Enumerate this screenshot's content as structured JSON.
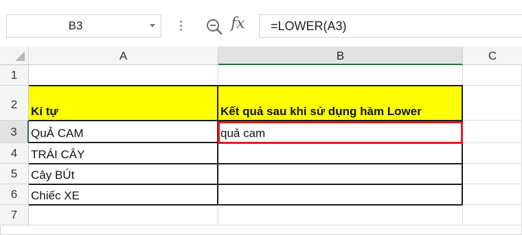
{
  "formula_bar": {
    "name_box": "B3",
    "formula": "=LOWER(A3)",
    "zoom_icon": "zoom-icon",
    "fx_label": "fx"
  },
  "columns": [
    "A",
    "B",
    "C"
  ],
  "rows": [
    "1",
    "2",
    "3",
    "4",
    "5",
    "6",
    "7"
  ],
  "cells": {
    "A2": "Kí tự",
    "B2": "Kết quả sau khi sử dụng hàm Lower",
    "A3": "QuẢ CAM",
    "B3": "quả cam",
    "A4": "TRÁI CÂY",
    "A5": "Cây BÚt",
    "A6": "Chiếc XE"
  },
  "colors": {
    "header_fill": "#ffff00",
    "selection_border": "#e01b1b",
    "active_header_accent": "#217346"
  }
}
